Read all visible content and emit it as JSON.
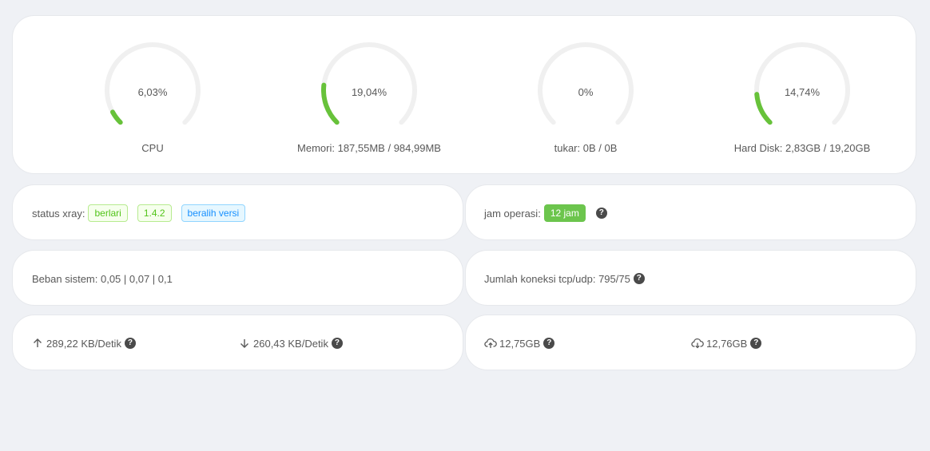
{
  "gauges": [
    {
      "value": "6,03%",
      "label": "CPU",
      "percent": 6.03
    },
    {
      "value": "19,04%",
      "label": "Memori: 187,55MB / 984,99MB",
      "percent": 19.04
    },
    {
      "value": "0%",
      "label": "tukar: 0B / 0B",
      "percent": 0
    },
    {
      "value": "14,74%",
      "label": "Hard Disk: 2,83GB / 19,20GB",
      "percent": 14.74
    }
  ],
  "xray": {
    "label": "status xray:",
    "state": "berlari",
    "version": "1.4.2",
    "switch_version": "beralih versi"
  },
  "uptime": {
    "label": "jam operasi:",
    "value": "12 jam"
  },
  "load": {
    "text": "Beban sistem: 0,05 | 0,07 | 0,1"
  },
  "connections": {
    "text": "Jumlah koneksi tcp/udp: 795/75"
  },
  "speed": {
    "upload": "289,22 KB/Detik",
    "download": "260,43 KB/Detik"
  },
  "traffic": {
    "sent": "12,75GB",
    "received": "12,76GB"
  },
  "help_glyph": "?",
  "colors": {
    "gauge_fill": "#67c23a",
    "gauge_track": "#f0f0f0",
    "background": "#eff1f5"
  }
}
